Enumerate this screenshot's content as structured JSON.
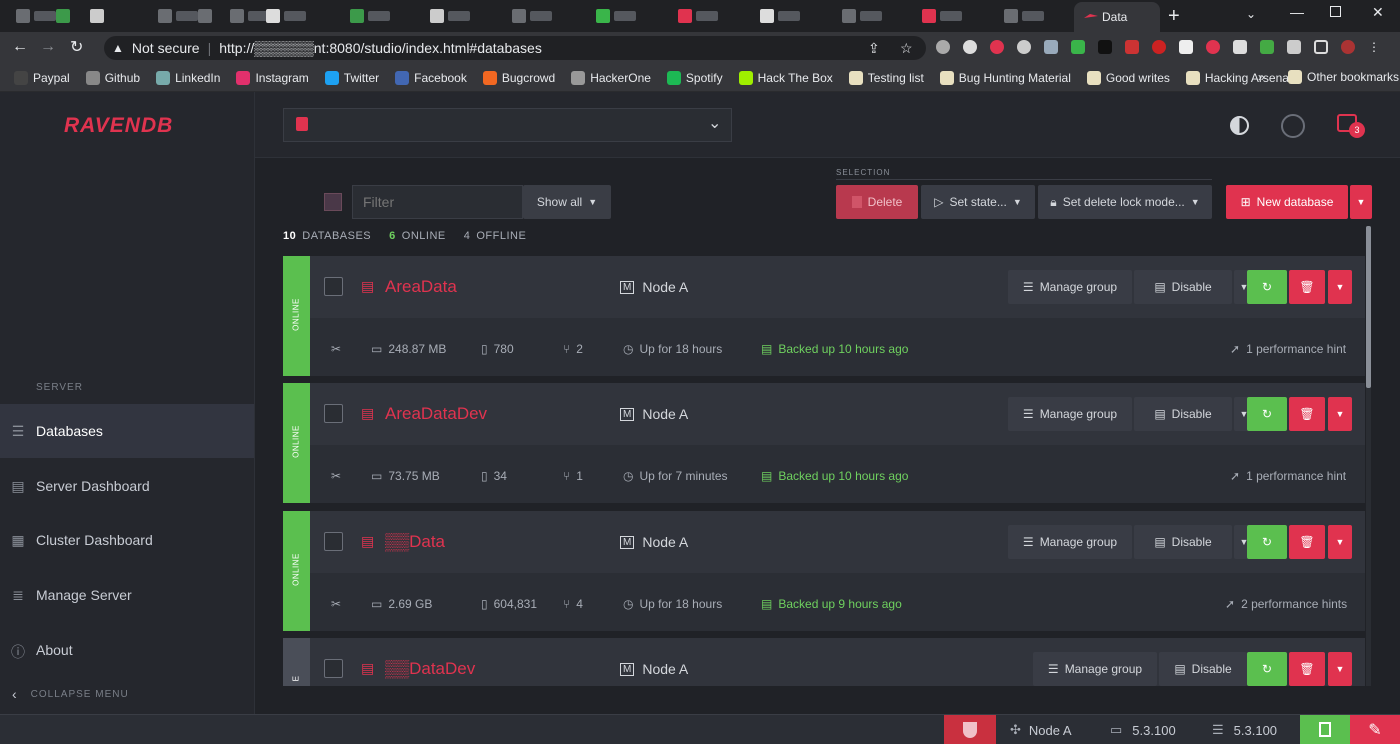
{
  "browser": {
    "active_tab_title": "Data",
    "url_security": "Not secure",
    "url": "http://▒▒▒▒▒▒nt:8080/studio/index.html#databases",
    "new_tab": "+",
    "bookmarks": [
      {
        "label": "Paypal",
        "color": "#444"
      },
      {
        "label": "Github",
        "color": "#888"
      },
      {
        "label": "LinkedIn",
        "color": "#7aa"
      },
      {
        "label": "Instagram",
        "color": "#e1306c"
      },
      {
        "label": "Twitter",
        "color": "#1da1f2"
      },
      {
        "label": "Facebook",
        "color": "#4267b2"
      },
      {
        "label": "Bugcrowd",
        "color": "#f26822"
      },
      {
        "label": "HackerOne",
        "color": "#999"
      },
      {
        "label": "Spotify",
        "color": "#1db954"
      },
      {
        "label": "Hack The Box",
        "color": "#9fef00"
      },
      {
        "label": "Testing list",
        "color": "#e8e0c0"
      },
      {
        "label": "Bug Hunting Material",
        "color": "#e8e0c0"
      },
      {
        "label": "Good writes",
        "color": "#e8e0c0"
      },
      {
        "label": "Hacking Arsenal",
        "color": "#e8e0c0"
      }
    ],
    "more": "»",
    "other_bookmarks": "Other bookmarks"
  },
  "app": {
    "logo": "RAVENDB",
    "accent": "#e0334f",
    "online_color": "#5bbf4f",
    "notifications_count": "3"
  },
  "sidebar": {
    "section": "SERVER",
    "items": [
      {
        "label": "Databases",
        "icon": "databases-icon",
        "active": true
      },
      {
        "label": "Server Dashboard",
        "icon": "dashboard-icon"
      },
      {
        "label": "Cluster Dashboard",
        "icon": "cluster-icon"
      },
      {
        "label": "Manage Server",
        "icon": "manage-icon"
      },
      {
        "label": "About",
        "icon": "info-icon"
      }
    ],
    "collapse": "COLLAPSE MENU"
  },
  "toolbar": {
    "filter_placeholder": "Filter",
    "show_all": "Show all",
    "selection_label": "SELECTION",
    "delete": "Delete",
    "set_state": "Set state...",
    "set_delete_lock": "Set delete lock mode...",
    "new_database": "New database"
  },
  "summary": {
    "total": "10",
    "total_label": "DATABASES",
    "online": "6",
    "online_label": "ONLINE",
    "offline": "4",
    "offline_label": "OFFLINE"
  },
  "databases": [
    {
      "name": "AreaData",
      "state": "ONLINE",
      "node": "Node A",
      "size": "248.87 MB",
      "docs": "780",
      "indexes": "2",
      "uptime": "Up for 18 hours",
      "backup": "Backed up 10 hours ago",
      "hints": "1 performance hint"
    },
    {
      "name": "AreaDataDev",
      "state": "ONLINE",
      "node": "Node A",
      "size": "73.75 MB",
      "docs": "34",
      "indexes": "1",
      "uptime": "Up for 7 minutes",
      "backup": "Backed up 10 hours ago",
      "hints": "1 performance hint"
    },
    {
      "name": "▒▒Data",
      "state": "ONLINE",
      "node": "Node A",
      "size": "2.69 GB",
      "docs": "604,831",
      "indexes": "4",
      "uptime": "Up for 18 hours",
      "backup": "Backed up 9 hours ago",
      "hints": "2 performance hints"
    },
    {
      "name": "▒▒DataDev",
      "state": "E",
      "node": "Node A"
    }
  ],
  "row_buttons": {
    "manage_group": "Manage group",
    "disable": "Disable"
  },
  "statusbar": {
    "node": "Node A",
    "version_client": "5.3.100",
    "version_server": "5.3.100"
  }
}
